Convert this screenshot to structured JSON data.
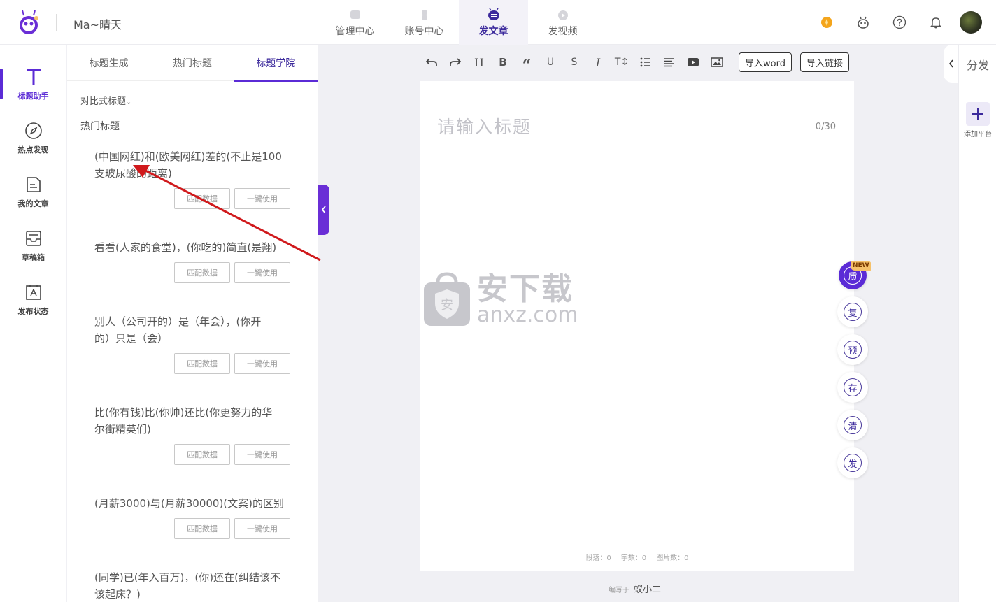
{
  "header": {
    "user_name": "Ma~晴天",
    "nav": [
      {
        "label": "管理中心",
        "icon": "manage-icon"
      },
      {
        "label": "账号中心",
        "icon": "account-icon"
      },
      {
        "label": "发文章",
        "icon": "article-icon",
        "active": true
      },
      {
        "label": "发视频",
        "icon": "video-icon"
      }
    ],
    "icons": [
      "coin-icon",
      "robot-icon",
      "help-icon",
      "bell-icon",
      "avatar"
    ]
  },
  "sidebar": {
    "items": [
      {
        "label": "标题助手",
        "icon": "title-t-icon",
        "active": true
      },
      {
        "label": "热点发现",
        "icon": "compass-icon"
      },
      {
        "label": "我的文章",
        "icon": "document-icon"
      },
      {
        "label": "草稿箱",
        "icon": "drafts-icon"
      },
      {
        "label": "发布状态",
        "icon": "publish-status-icon"
      }
    ]
  },
  "panel": {
    "tabs": [
      "标题生成",
      "热门标题",
      "标题学院"
    ],
    "active_tab": 2,
    "dropdown": "对比式标题",
    "section_label": "热门标题",
    "match_label": "匹配数据",
    "use_label": "一键使用",
    "titles": [
      {
        "line1": "(中国网红)和(欧美网红)差的(不止是100",
        "line2": "支玻尿酸的距离)"
      },
      {
        "line1": "看看(人家的食堂)，(你吃的)简直(是翔)",
        "line2": ""
      },
      {
        "line1": "别人（公司开的）是（年会），(你开",
        "line2": "的）只是（会）"
      },
      {
        "line1": "比(你有钱)比(你帅)还比(你更努力的华",
        "line2": "尔街精英们)"
      },
      {
        "line1": "(月薪3000)与(月薪30000)(文案)的区别",
        "line2": ""
      },
      {
        "line1": "(同学)已(年入百万)，(你)还在(纠结该不",
        "line2": "该起床？)"
      }
    ]
  },
  "toolbar": {
    "tools": [
      "undo-icon",
      "redo-icon",
      "heading-icon",
      "bold-icon",
      "quote-icon",
      "underline-icon",
      "strikethrough-icon",
      "italic-icon",
      "font-size-icon",
      "list-icon",
      "align-icon",
      "video-embed-icon",
      "image-icon"
    ],
    "import_word": "导入word",
    "import_link": "导入链接"
  },
  "editor": {
    "title_placeholder": "请输入标题",
    "counter": "0/30",
    "stats": {
      "paragraphs": "段落：0",
      "words": "字数：0",
      "images": "图片数：0"
    },
    "footer_prefix": "编写于",
    "footer_name": "蚁小二"
  },
  "float_buttons": [
    {
      "label": "质",
      "badge": "NEW"
    },
    {
      "label": "复"
    },
    {
      "label": "预"
    },
    {
      "label": "存"
    },
    {
      "label": "清"
    },
    {
      "label": "发"
    }
  ],
  "right_panel": {
    "title": "分发",
    "add_label": "添加平台"
  },
  "watermark": {
    "cn": "安下载",
    "en": "anxz.com",
    "shield_char": "安"
  },
  "colors": {
    "accent": "#5b2bd6",
    "dark_accent": "#3c2a9c",
    "annotation_arrow": "#d0191c"
  }
}
